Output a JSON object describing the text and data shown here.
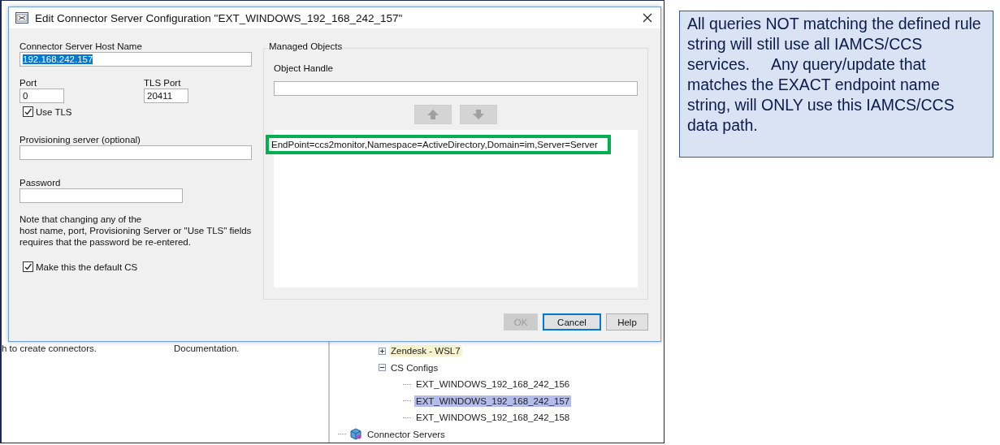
{
  "background_app": {
    "left_texts": [
      "h to create connectors.",
      "Documentation."
    ],
    "tree": {
      "items": [
        {
          "label": "Zendesk - WSL7",
          "expanded": false,
          "highlighted": true
        },
        {
          "label": "CS Configs",
          "expanded": true,
          "children": [
            {
              "label": "EXT_WINDOWS_192_168_242_156",
              "selected": false
            },
            {
              "label": "EXT_WINDOWS_192_168_242_157",
              "selected": true
            },
            {
              "label": "EXT_WINDOWS_192_168_242_158",
              "selected": false
            }
          ]
        }
      ],
      "root_item": {
        "label": "Connector Servers"
      }
    }
  },
  "dialog": {
    "title": "Edit Connector Server Configuration \"EXT_WINDOWS_192_168_242_157\"",
    "host_name": {
      "label": "Connector Server Host Name",
      "value": "192.168.242.157",
      "value_selected": true
    },
    "port": {
      "label": "Port",
      "value": "0"
    },
    "tls_port": {
      "label": "TLS Port",
      "value": "20411"
    },
    "use_tls": {
      "label": "Use TLS",
      "checked": true
    },
    "provisioning_server": {
      "label": "Provisioning server (optional)"
    },
    "password": {
      "label": "Password"
    },
    "note": "Note that changing any of the\nhost name, port, Provisioning Server or \"Use TLS\" fields\nrequires that the password be re-entered.",
    "default_cs": {
      "label": "Make this the default CS",
      "checked": true
    },
    "managed_objects": {
      "title": "Managed Objects",
      "object_handle": {
        "label": "Object Handle"
      },
      "move_buttons": [
        {
          "kind": "up",
          "disabled": true
        },
        {
          "kind": "down",
          "disabled": true
        }
      ],
      "entries": [
        {
          "text": "EndPoint=ccs2monitor,Namespace=ActiveDirectory,Domain=im,Server=Server",
          "highlighted": true
        }
      ]
    },
    "buttons": [
      {
        "label": "OK",
        "disabled": true,
        "default": false
      },
      {
        "label": "Cancel",
        "disabled": false,
        "default": true
      },
      {
        "label": "Help",
        "disabled": false,
        "default": false
      }
    ]
  },
  "callout": {
    "text": "All queries NOT matching the defined rule string will still use all IAMCS/CCS services.     Any query/update that matches the EXACT endpoint name string, will ONLY use this IAMCS/CCS data path."
  }
}
